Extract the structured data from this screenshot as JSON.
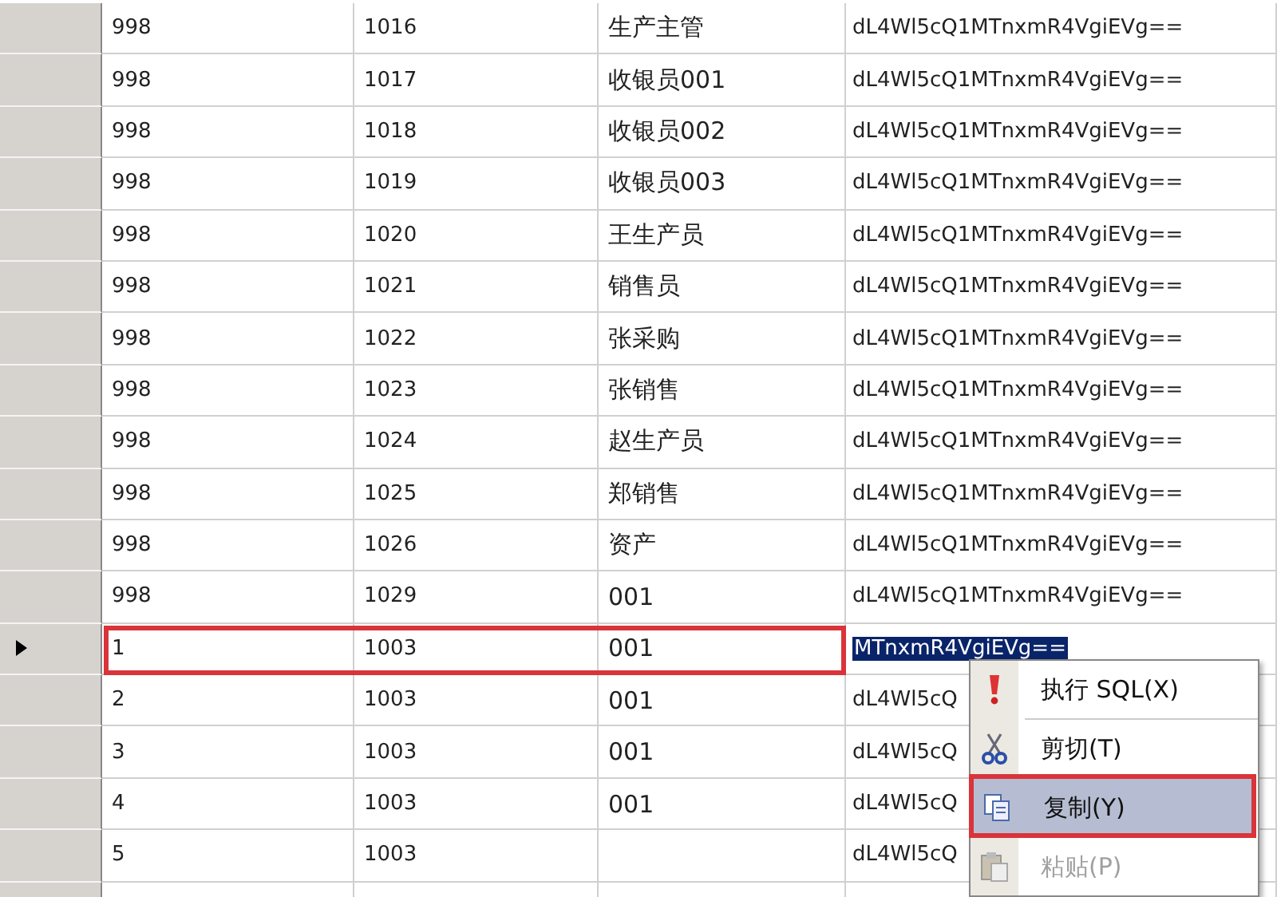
{
  "rows": [
    {
      "c1": "998",
      "c2": "1016",
      "c3": "生产主管",
      "c4": "dL4Wl5cQ1MTnxmR4VgiEVg==",
      "current": false
    },
    {
      "c1": "998",
      "c2": "1017",
      "c3": "收银员001",
      "c4": "dL4Wl5cQ1MTnxmR4VgiEVg==",
      "current": false
    },
    {
      "c1": "998",
      "c2": "1018",
      "c3": "收银员002",
      "c4": "dL4Wl5cQ1MTnxmR4VgiEVg==",
      "current": false
    },
    {
      "c1": "998",
      "c2": "1019",
      "c3": "收银员003",
      "c4": "dL4Wl5cQ1MTnxmR4VgiEVg==",
      "current": false
    },
    {
      "c1": "998",
      "c2": "1020",
      "c3": "王生产员",
      "c4": "dL4Wl5cQ1MTnxmR4VgiEVg==",
      "current": false
    },
    {
      "c1": "998",
      "c2": "1021",
      "c3": "销售员",
      "c4": "dL4Wl5cQ1MTnxmR4VgiEVg==",
      "current": false
    },
    {
      "c1": "998",
      "c2": "1022",
      "c3": "张采购",
      "c4": "dL4Wl5cQ1MTnxmR4VgiEVg==",
      "current": false
    },
    {
      "c1": "998",
      "c2": "1023",
      "c3": "张销售",
      "c4": "dL4Wl5cQ1MTnxmR4VgiEVg==",
      "current": false
    },
    {
      "c1": "998",
      "c2": "1024",
      "c3": "赵生产员",
      "c4": "dL4Wl5cQ1MTnxmR4VgiEVg==",
      "current": false
    },
    {
      "c1": "998",
      "c2": "1025",
      "c3": "郑销售",
      "c4": "dL4Wl5cQ1MTnxmR4VgiEVg==",
      "current": false
    },
    {
      "c1": "998",
      "c2": "1026",
      "c3": "资产",
      "c4": "dL4Wl5cQ1MTnxmR4VgiEVg==",
      "current": false
    },
    {
      "c1": "998",
      "c2": "1029",
      "c3": "001",
      "c4": "dL4Wl5cQ1MTnxmR4VgiEVg==",
      "current": false
    },
    {
      "c1": "1",
      "c2": "1003",
      "c3": "001",
      "c4": "MTnxmR4VgiEVg==",
      "current": true
    },
    {
      "c1": "2",
      "c2": "1003",
      "c3": "001",
      "c4": "dL4Wl5cQ",
      "current": false
    },
    {
      "c1": "3",
      "c2": "1003",
      "c3": "001",
      "c4": "dL4Wl5cQ",
      "current": false
    },
    {
      "c1": "4",
      "c2": "1003",
      "c3": "001",
      "c4": "dL4Wl5cQ",
      "current": false
    },
    {
      "c1": "5",
      "c2": "1003",
      "c4": "dL4Wl5cQ",
      "current": false
    }
  ],
  "context_menu": {
    "items": [
      {
        "label": "执行 SQL(X)",
        "kind": "run",
        "selected": false,
        "disabled": false
      },
      {
        "label": "剪切(T)",
        "kind": "cut",
        "selected": false,
        "disabled": false
      },
      {
        "label": "复制(Y)",
        "kind": "copy",
        "selected": true,
        "disabled": false
      },
      {
        "label": "粘贴(P)",
        "kind": "paste",
        "selected": false,
        "disabled": true
      }
    ]
  }
}
